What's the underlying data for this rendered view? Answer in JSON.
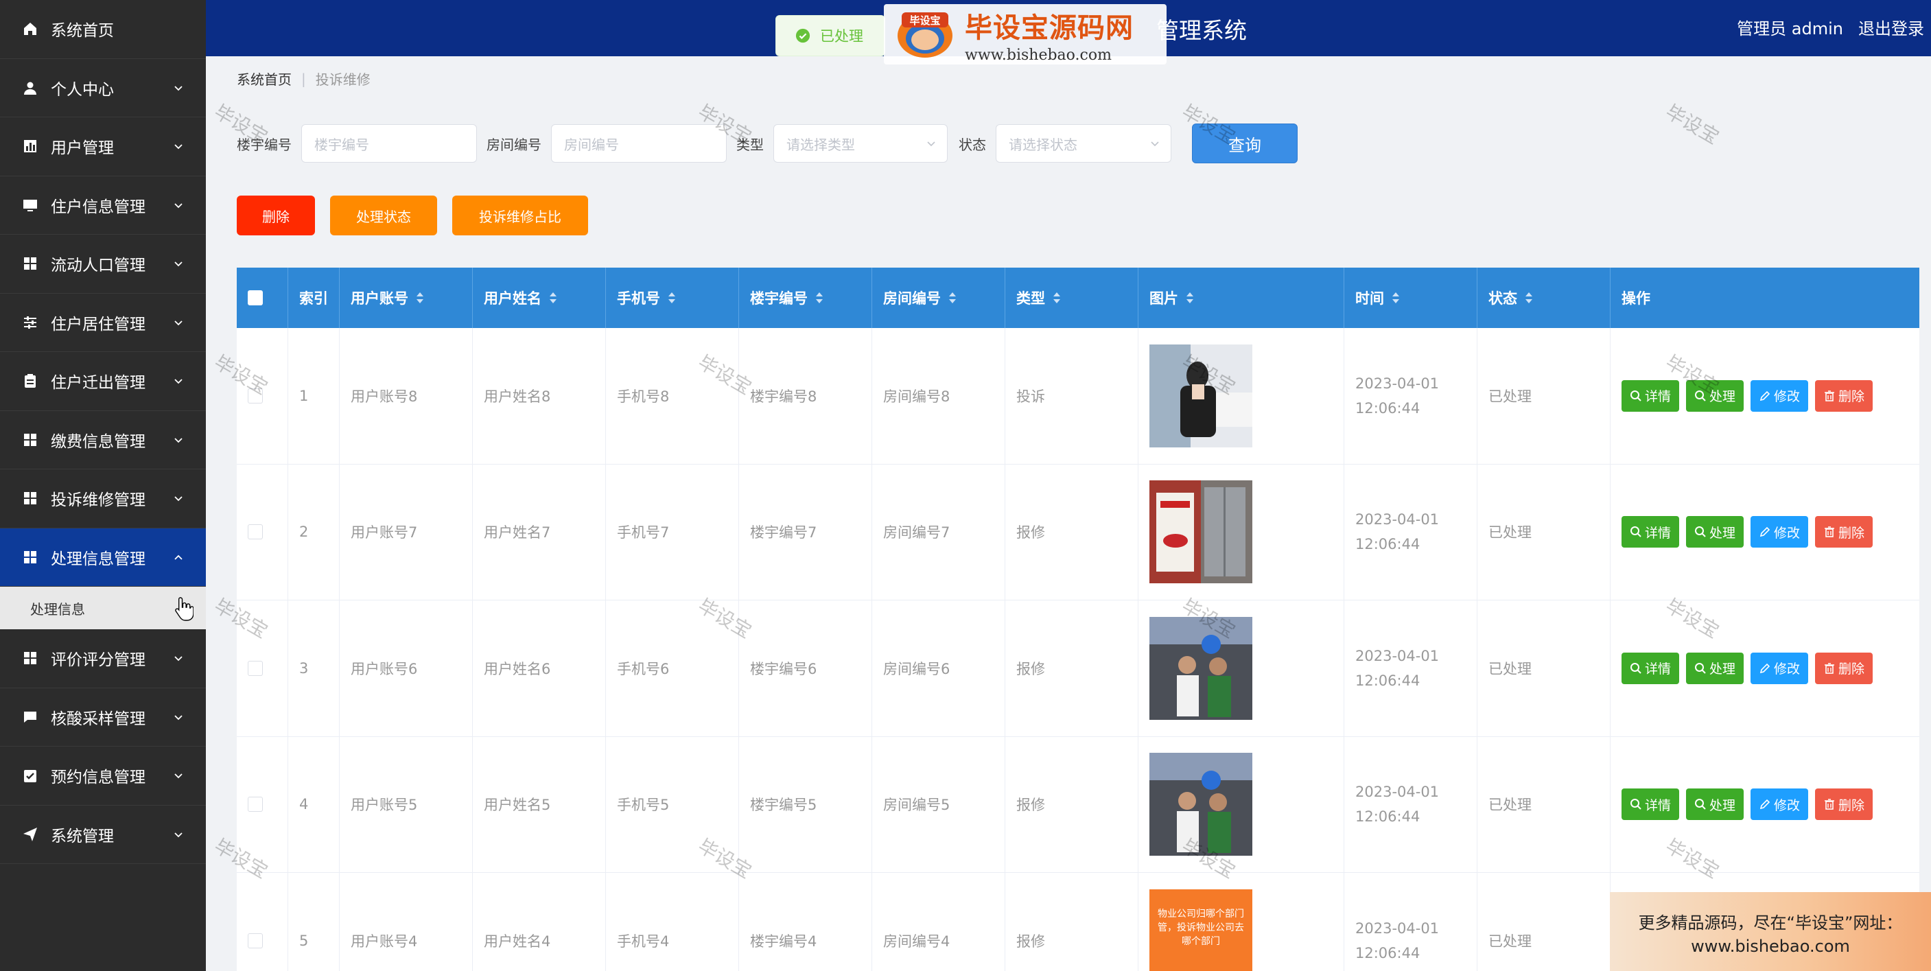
{
  "sidebar": {
    "items": [
      {
        "label": "系统首页",
        "icon": "home-icon"
      },
      {
        "label": "个人中心",
        "icon": "user-icon"
      },
      {
        "label": "用户管理",
        "icon": "chart-icon"
      },
      {
        "label": "住户信息管理",
        "icon": "monitor-icon"
      },
      {
        "label": "流动人口管理",
        "icon": "grid-icon"
      },
      {
        "label": "住户居住管理",
        "icon": "sliders-icon"
      },
      {
        "label": "住户迁出管理",
        "icon": "clipboard-icon"
      },
      {
        "label": "缴费信息管理",
        "icon": "grid-icon"
      },
      {
        "label": "投诉维修管理",
        "icon": "grid-icon"
      },
      {
        "label": "处理信息管理",
        "icon": "grid-icon"
      },
      {
        "label": "评价评分管理",
        "icon": "grid-icon"
      },
      {
        "label": "核酸采样管理",
        "icon": "chat-icon"
      },
      {
        "label": "预约信息管理",
        "icon": "check-icon"
      },
      {
        "label": "系统管理",
        "icon": "send-icon"
      }
    ],
    "submenu_label": "处理信息"
  },
  "header": {
    "title": "管理系统",
    "user": "管理员 admin",
    "logout": "退出登录"
  },
  "toast": {
    "text": "已处理"
  },
  "brand": {
    "logo_text": "毕设宝",
    "name": "毕设宝源码网",
    "url": "www.bishebao.com"
  },
  "breadcrumb": {
    "home": "系统首页",
    "sep": "|",
    "current": "投诉维修"
  },
  "search": {
    "building_label": "楼宇编号",
    "building_placeholder": "楼宇编号",
    "room_label": "房间编号",
    "room_placeholder": "房间编号",
    "type_label": "类型",
    "type_placeholder": "请选择类型",
    "status_label": "状态",
    "status_placeholder": "请选择状态",
    "query_label": "查询"
  },
  "actions": {
    "delete": "删除",
    "process_status": "处理状态",
    "ratio": "投诉维修占比"
  },
  "table": {
    "headers": {
      "index": "索引",
      "account": "用户账号",
      "name": "用户姓名",
      "phone": "手机号",
      "building": "楼宇编号",
      "room": "房间编号",
      "type": "类型",
      "image": "图片",
      "time": "时间",
      "status": "状态",
      "ops": "操作"
    },
    "rows": [
      {
        "index": "1",
        "account": "用户账号8",
        "name": "用户姓名8",
        "phone": "手机号8",
        "building": "楼宇编号8",
        "room": "房间编号8",
        "type": "投诉",
        "time": "2023-04-01 12:06:44",
        "status": "已处理"
      },
      {
        "index": "2",
        "account": "用户账号7",
        "name": "用户姓名7",
        "phone": "手机号7",
        "building": "楼宇编号7",
        "room": "房间编号7",
        "type": "报修",
        "time": "2023-04-01 12:06:44",
        "status": "已处理"
      },
      {
        "index": "3",
        "account": "用户账号6",
        "name": "用户姓名6",
        "phone": "手机号6",
        "building": "楼宇编号6",
        "room": "房间编号6",
        "type": "报修",
        "time": "2023-04-01 12:06:44",
        "status": "已处理"
      },
      {
        "index": "4",
        "account": "用户账号5",
        "name": "用户姓名5",
        "phone": "手机号5",
        "building": "楼宇编号5",
        "room": "房间编号5",
        "type": "报修",
        "time": "2023-04-01 12:06:44",
        "status": "已处理"
      },
      {
        "index": "5",
        "account": "用户账号4",
        "name": "用户姓名4",
        "phone": "手机号4",
        "building": "楼宇编号4",
        "room": "房间编号4",
        "type": "报修",
        "time": "2023-04-01 12:06:44",
        "status": "已处理"
      }
    ],
    "row_ops": {
      "detail": "详情",
      "process": "处理",
      "edit": "修改",
      "delete": "删除"
    },
    "row5_image_text": "物业公司归哪个部门管，投诉物业公司去哪个部门"
  },
  "watermark_text": "毕设宝",
  "promo": {
    "line1": "更多精品源码，尽在“毕设宝”网址：",
    "line2": "www.bishebao.com"
  },
  "colors": {
    "sidebar_bg": "#2c2c2c",
    "header_bg": "#0b2d86",
    "table_header": "#2f88d6",
    "active_menu": "#0d3b99"
  }
}
